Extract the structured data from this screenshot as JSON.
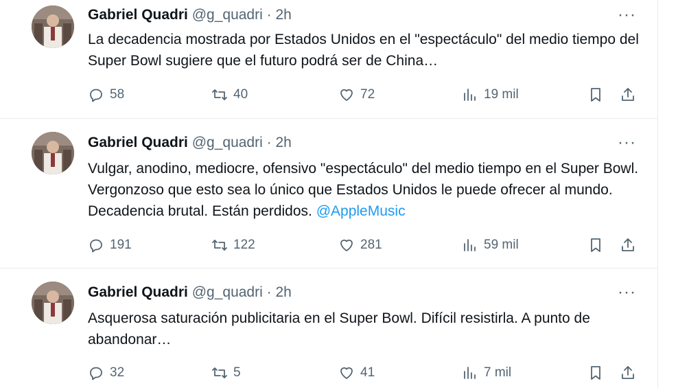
{
  "tweets": [
    {
      "name": "Gabriel Quadri",
      "handle": "@g_quadri",
      "dot": "·",
      "time": "2h",
      "text": "La decadencia mostrada por Estados Unidos en el \"espectáculo\" del medio tiempo del Super Bowl sugiere que el futuro podrá ser de China…",
      "mention": "",
      "replies": "58",
      "retweets": "40",
      "likes": "72",
      "views": "19 mil"
    },
    {
      "name": "Gabriel Quadri",
      "handle": "@g_quadri",
      "dot": "·",
      "time": "2h",
      "text": "Vulgar, anodino, mediocre, ofensivo \"espectáculo\" del medio tiempo en el Super Bowl. Vergonzoso que esto sea lo único que Estados Unidos le puede ofrecer al mundo. Decadencia brutal. Están perdidos. ",
      "mention": "@AppleMusic",
      "replies": "191",
      "retweets": "122",
      "likes": "281",
      "views": "59 mil"
    },
    {
      "name": "Gabriel Quadri",
      "handle": "@g_quadri",
      "dot": "·",
      "time": "2h",
      "text": "Asquerosa saturación publicitaria en el Super Bowl. Difícil resistirla. A punto de abandonar…",
      "mention": "",
      "replies": "32",
      "retweets": "5",
      "likes": "41",
      "views": "7 mil"
    }
  ],
  "more_label": "···",
  "icons": {
    "reply": "reply-icon",
    "retweet": "retweet-icon",
    "like": "heart-icon",
    "views": "views-icon",
    "bookmark": "bookmark-icon",
    "share": "share-icon"
  },
  "colors": {
    "text": "#0f1419",
    "secondary": "#536471",
    "link": "#1d9bf0",
    "divider": "#e6ecf0"
  }
}
